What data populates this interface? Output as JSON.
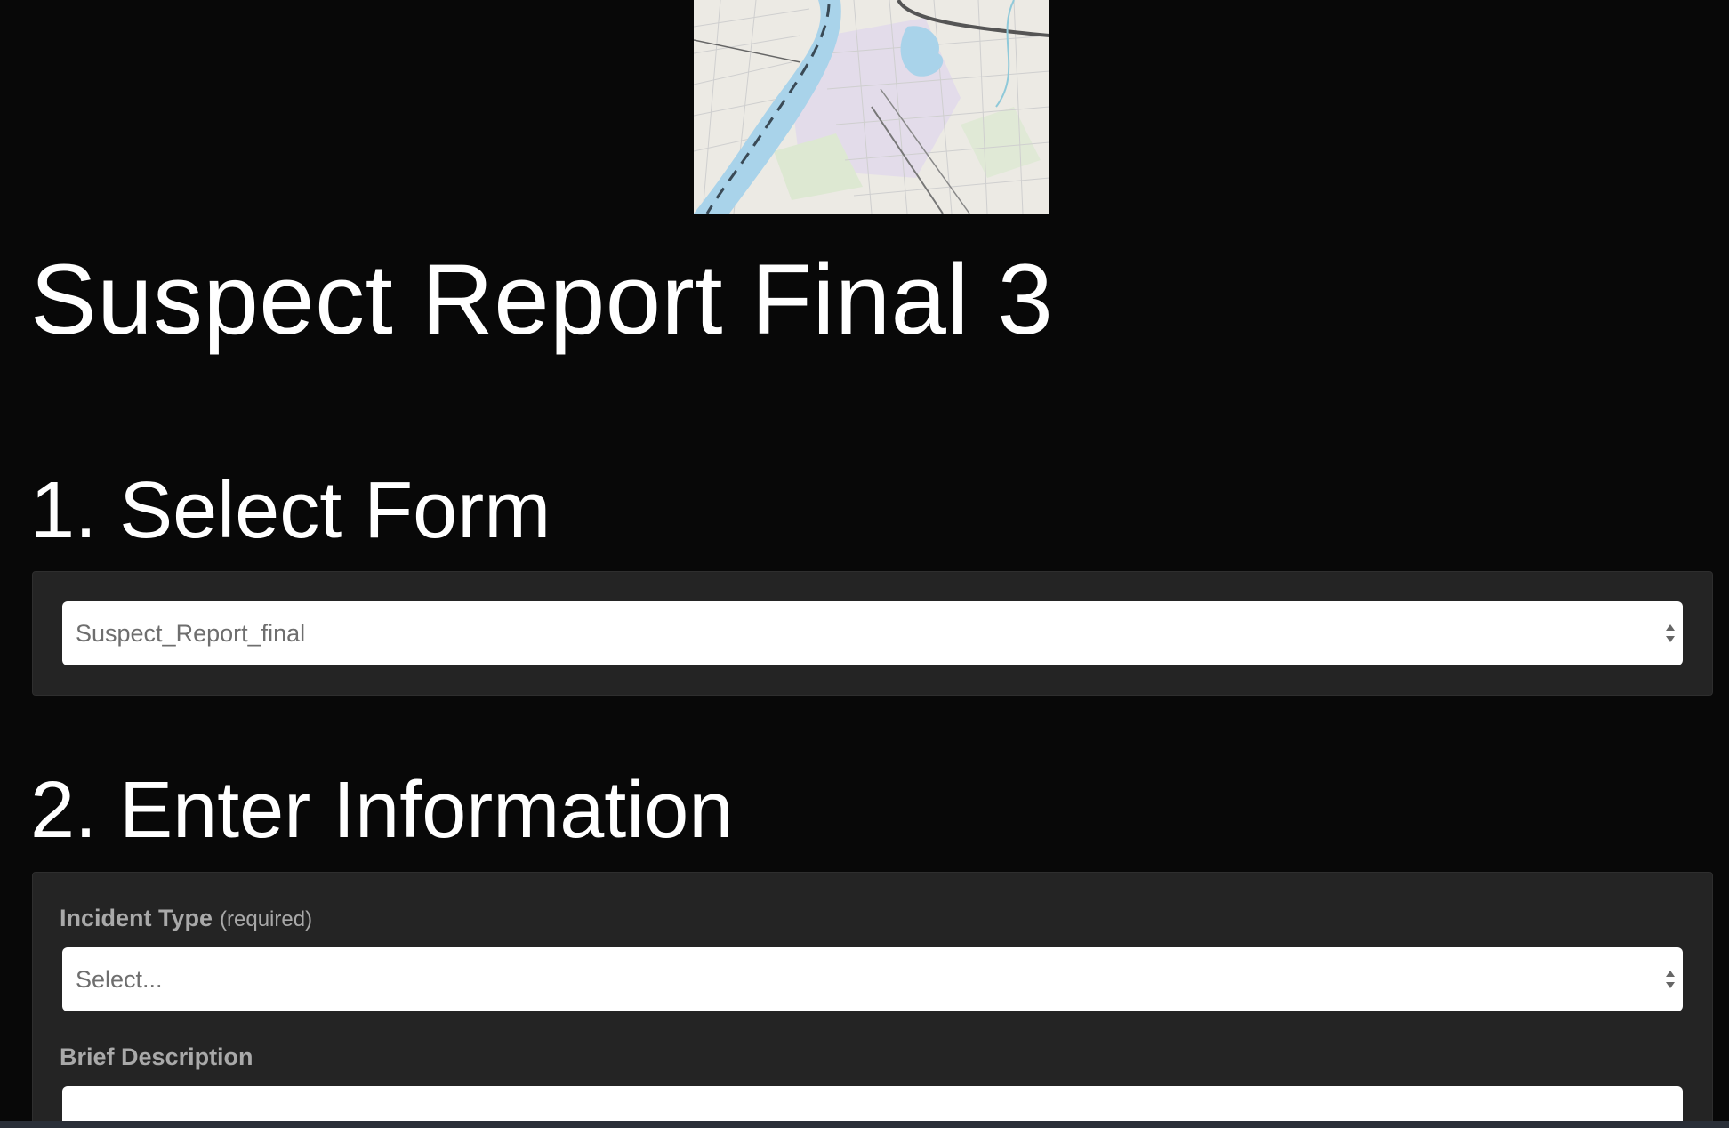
{
  "map": {
    "alt": "map-thumbnail"
  },
  "title": "Suspect Report Final 3",
  "steps": {
    "select_form": {
      "heading": "1. Select Form",
      "selected_form": "Suspect_Report_final"
    },
    "enter_information": {
      "heading": "2. Enter Information",
      "incident_type": {
        "label": "Incident Type",
        "hint": "(required)",
        "value": "Select..."
      },
      "brief_description": {
        "label": "Brief Description",
        "value": ""
      }
    }
  },
  "colors": {
    "background": "#080808",
    "panel": "#242424",
    "label": "#a9a9a9",
    "input_text": "#6e6e6e"
  }
}
